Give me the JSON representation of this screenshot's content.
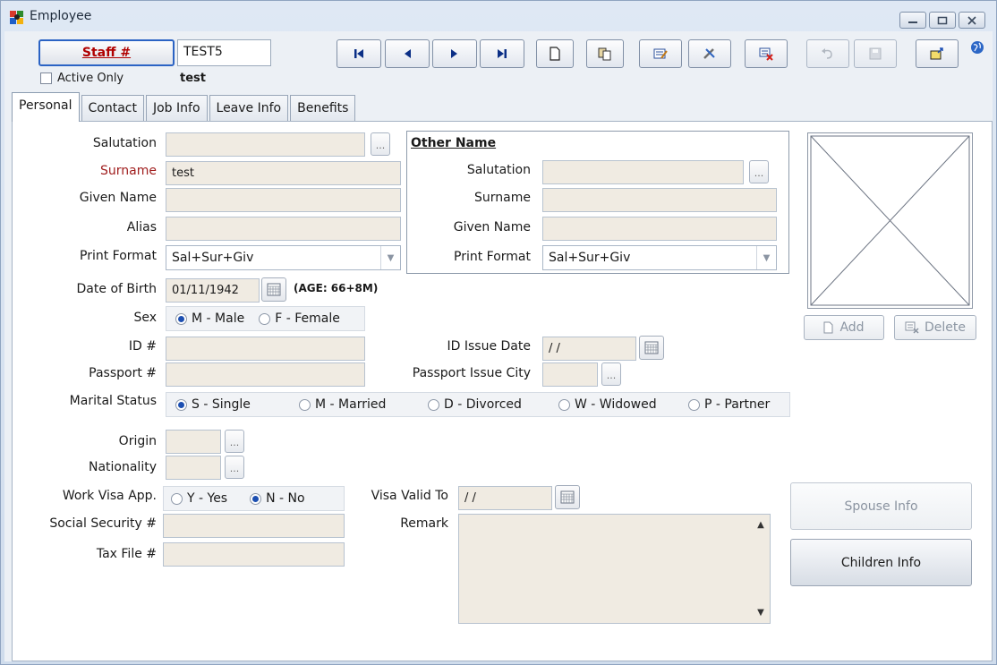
{
  "window": {
    "title": "Employee"
  },
  "header": {
    "staff_label": "Staff #",
    "staff_value": "TEST5",
    "active_only_label": "Active Only",
    "employee_name": "test"
  },
  "toolbar": {
    "icons": [
      "first-record-icon",
      "prev-record-icon",
      "next-record-icon",
      "last-record-icon",
      "new-record-icon",
      "copy-record-icon",
      "edit-record-icon",
      "tools-icon",
      "delete-record-icon",
      "undo-icon",
      "save-icon",
      "export-icon",
      "globe-icon"
    ]
  },
  "tabs": [
    {
      "label": "Personal",
      "active": true
    },
    {
      "label": "Contact"
    },
    {
      "label": "Job Info"
    },
    {
      "label": "Leave Info"
    },
    {
      "label": "Benefits"
    }
  ],
  "personal": {
    "salutation_label": "Salutation",
    "salutation_value": "",
    "surname_label": "Surname",
    "surname_value": "test",
    "given_name_label": "Given Name",
    "given_name_value": "",
    "alias_label": "Alias",
    "alias_value": "",
    "print_format_label": "Print Format",
    "print_format_value": "Sal+Sur+Giv",
    "dob_label": "Date of Birth",
    "dob_value": "01/11/1942",
    "age_text": "(AGE: 66+8M)",
    "sex_label": "Sex",
    "sex_options": [
      "M - Male",
      "F - Female"
    ],
    "sex_selected": "M - Male",
    "id_label": "ID #",
    "id_value": "",
    "passport_label": "Passport #",
    "passport_value": "",
    "id_issue_date_label": "ID Issue Date",
    "id_issue_date_value": " / /",
    "passport_issue_city_label": "Passport Issue City",
    "passport_issue_city_value": "",
    "marital_label": "Marital Status",
    "marital_options": [
      "S   - Single",
      "M   - Married",
      "D  - Divorced",
      "W  - Widowed",
      "P  - Partner"
    ],
    "marital_selected": "S   - Single",
    "origin_label": "Origin",
    "origin_value": "",
    "nationality_label": "Nationality",
    "nationality_value": "",
    "work_visa_label": "Work Visa App.",
    "work_visa_options": [
      "Y - Yes",
      "N - No"
    ],
    "work_visa_selected": "N - No",
    "visa_valid_label": "Visa Valid To",
    "visa_valid_value": " / /",
    "ssn_label": "Social Security #",
    "ssn_value": "",
    "tax_file_label": "Tax File #",
    "tax_file_value": "",
    "remark_label": "Remark",
    "remark_value": ""
  },
  "other_name": {
    "title": "Other Name",
    "salutation_label": "Salutation",
    "salutation_value": "",
    "surname_label": "Surname",
    "surname_value": "",
    "given_name_label": "Given Name",
    "given_name_value": "",
    "print_format_label": "Print Format",
    "print_format_value": "Sal+Sur+Giv"
  },
  "photo": {
    "add_label": "Add",
    "delete_label": "Delete"
  },
  "buttons": {
    "spouse_info": "Spouse Info",
    "children_info": "Children Info"
  },
  "misc": {
    "ellipsis": "..."
  }
}
